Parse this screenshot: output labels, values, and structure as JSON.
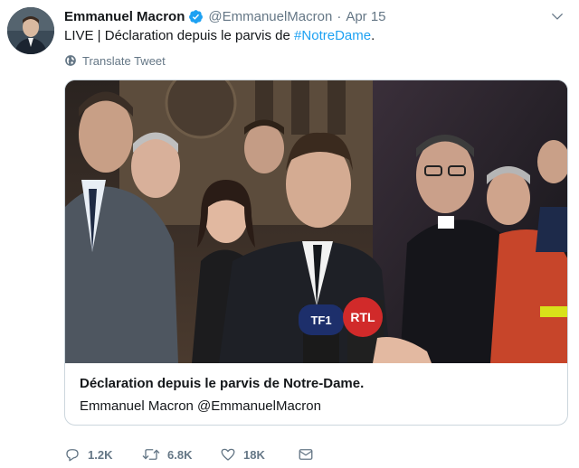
{
  "tweet": {
    "author_name": "Emmanuel Macron",
    "handle": "@EmmanuelMacron",
    "separator": "·",
    "date": "Apr 15",
    "text_prefix": "LIVE | Déclaration depuis le parvis de ",
    "hashtag": "#NotreDame",
    "text_suffix": ".",
    "translate_label": "Translate Tweet"
  },
  "card": {
    "title": "Déclaration depuis le parvis de Notre-Dame.",
    "subtitle": "Emmanuel Macron @EmmanuelMacron",
    "media_description": "Live video frame showing a group of people at night in front of the Notre-Dame cathedral facade with microphones",
    "mic_labels": [
      "TF1",
      "RTL"
    ]
  },
  "actions": {
    "reply_count": "1.2K",
    "retweet_count": "6.8K",
    "like_count": "18K"
  },
  "icons": {
    "verified": "verified-badge-icon",
    "chevron": "chevron-down-icon",
    "globe": "globe-icon",
    "reply": "reply-icon",
    "retweet": "retweet-icon",
    "like": "heart-icon",
    "share": "share-mail-icon"
  },
  "colors": {
    "accent": "#1da1f2",
    "muted": "#657786",
    "text": "#14171a",
    "border": "#ccd6dd"
  }
}
